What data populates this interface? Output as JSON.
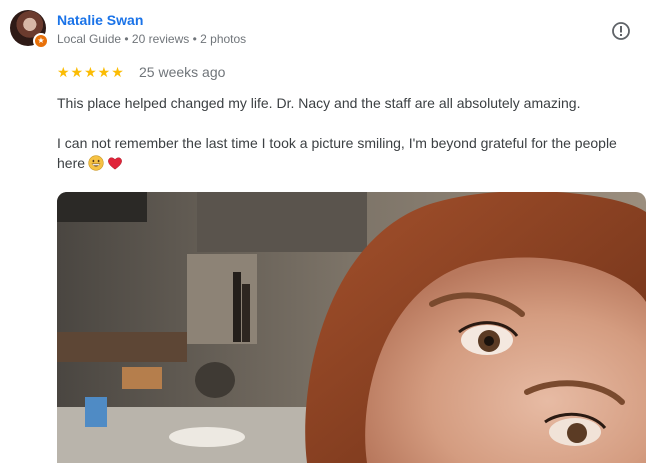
{
  "reviewer": {
    "name": "Natalie Swan",
    "meta": "Local Guide • 20 reviews • 2 photos",
    "badge_icon": "star-badge-icon"
  },
  "review": {
    "rating": 5,
    "stars": "★★★★★",
    "time": "25 weeks ago",
    "paragraph_1": "This place helped changed my life. Dr. Nacy and the staff are all absolutely amazing.",
    "paragraph_2": "I can not remember the last time I took a picture smiling, I'm beyond grateful for the people here",
    "emojis": [
      "grinning-face-icon",
      "red-heart-icon"
    ]
  },
  "colors": {
    "name": "#1a73e8",
    "stars": "#fbbc04",
    "meta": "#70757a"
  }
}
